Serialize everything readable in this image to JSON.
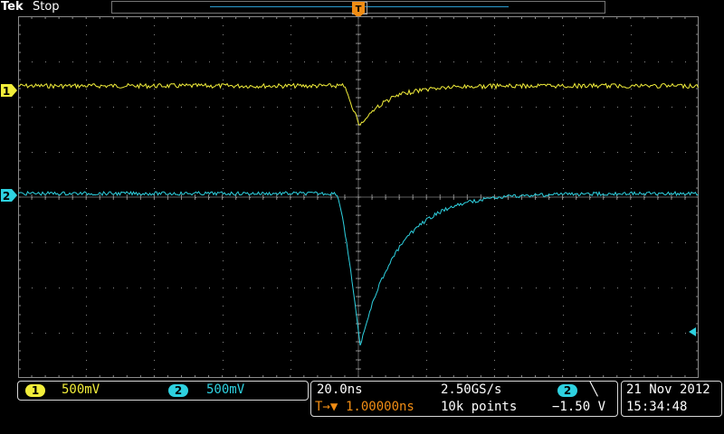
{
  "header": {
    "brand": "Tek",
    "acq_state": "Stop"
  },
  "trigger_marker": "T",
  "channels": [
    {
      "number": "1",
      "color": "#f2ee3a",
      "scale": "500mV"
    },
    {
      "number": "2",
      "color": "#2ed1e0",
      "scale": "500mV"
    }
  ],
  "horizontal": {
    "time_per_div": "20.0ns",
    "sample_rate": "2.50GS/s",
    "record_length": "10k points",
    "delay_prefix": "T→▼",
    "delay": "1.00000ns"
  },
  "trigger": {
    "source": "2",
    "slope_icon": "falling-edge",
    "slope_glyph": "╲",
    "level": "−1.50 V"
  },
  "datetime": {
    "date": "21 Nov 2012",
    "time": "15:34:48"
  },
  "colors": {
    "accent_orange": "#f08c14",
    "graticule": "#8a8a8a"
  }
}
